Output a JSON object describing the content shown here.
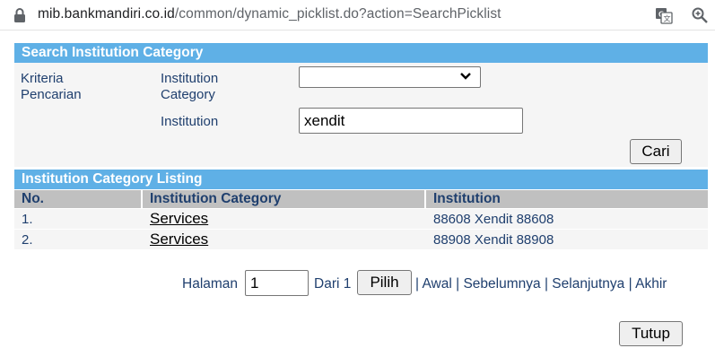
{
  "browser": {
    "url_host": "mib.bankmandiri.co.id",
    "url_path": "/common/dynamic_picklist.do?action=SearchPicklist"
  },
  "search": {
    "title": "Search Institution Category",
    "criteria_label_1": "Kriteria",
    "criteria_label_2": "Pencarian",
    "category_label_1": "Institution",
    "category_label_2": "Category",
    "category_selected": "",
    "institution_label": "Institution",
    "institution_value": "xendit",
    "search_button": "Cari"
  },
  "listing": {
    "title": "Institution Category Listing",
    "columns": [
      "No.",
      "Institution Category",
      "Institution"
    ],
    "rows": [
      {
        "no": "1.",
        "category": "Services",
        "institution": "88608 Xendit 88608"
      },
      {
        "no": "2.",
        "category": "Services",
        "institution": "88908 Xendit 88908"
      }
    ]
  },
  "pagination": {
    "page_label": "Halaman",
    "page_value": "1",
    "of_label": "Dari 1",
    "go_button": "Pilih",
    "sep": "|",
    "first": "Awal",
    "prev": "Sebelumnya",
    "next": "Selanjutnya",
    "last": "Akhir"
  },
  "footer": {
    "close_button": "Tutup"
  },
  "colors": {
    "header_blue": "#5fb0e6",
    "table_header_gray": "#c0c0c0",
    "text_navy": "#1f3f6e"
  }
}
